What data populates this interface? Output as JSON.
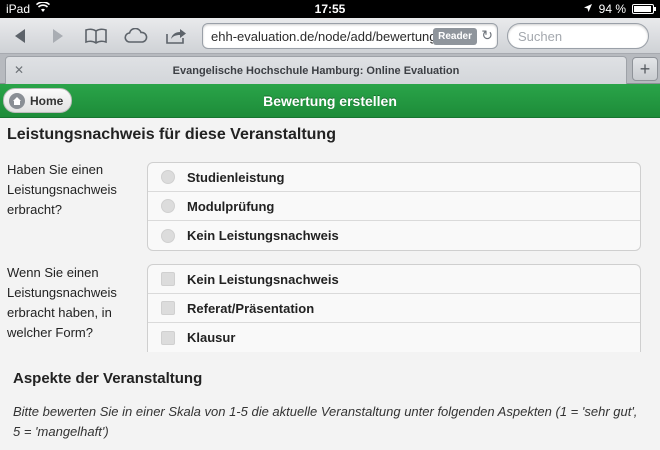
{
  "statusbar": {
    "device": "iPad",
    "time": "17:55",
    "battery": "94 %",
    "battery_level": 0.94
  },
  "toolbar": {
    "url": "ehh-evaluation.de/node/add/bewertung",
    "reader_label": "Reader",
    "search_placeholder": "Suchen"
  },
  "tab": {
    "title": "Evangelische Hochschule Hamburg: Online Evaluation"
  },
  "header": {
    "home_label": "Home",
    "title": "Bewertung erstellen"
  },
  "content": {
    "section_title": "Leistungsnachweis für diese Veranstaltung",
    "q1": {
      "label": "Haben Sie einen Leistungsnachweis erbracht?",
      "options": [
        "Studienleistung",
        "Modulprüfung",
        "Kein Leistungsnachweis"
      ]
    },
    "q2": {
      "label": "Wenn Sie einen Leistungsnachweis erbracht haben, in welcher Form?",
      "options": [
        "Kein Leistungsnachweis",
        "Referat/Präsentation",
        "Klausur"
      ]
    },
    "aspects_title": "Aspekte der Veranstaltung",
    "aspects_text": "Bitte bewerten Sie in einer Skala von 1-5 die aktuelle Veranstaltung unter folgenden Aspekten (1 = 'sehr gut', 5 = 'mangelhaft')"
  },
  "colors": {
    "header_green": "#1d8c39"
  }
}
